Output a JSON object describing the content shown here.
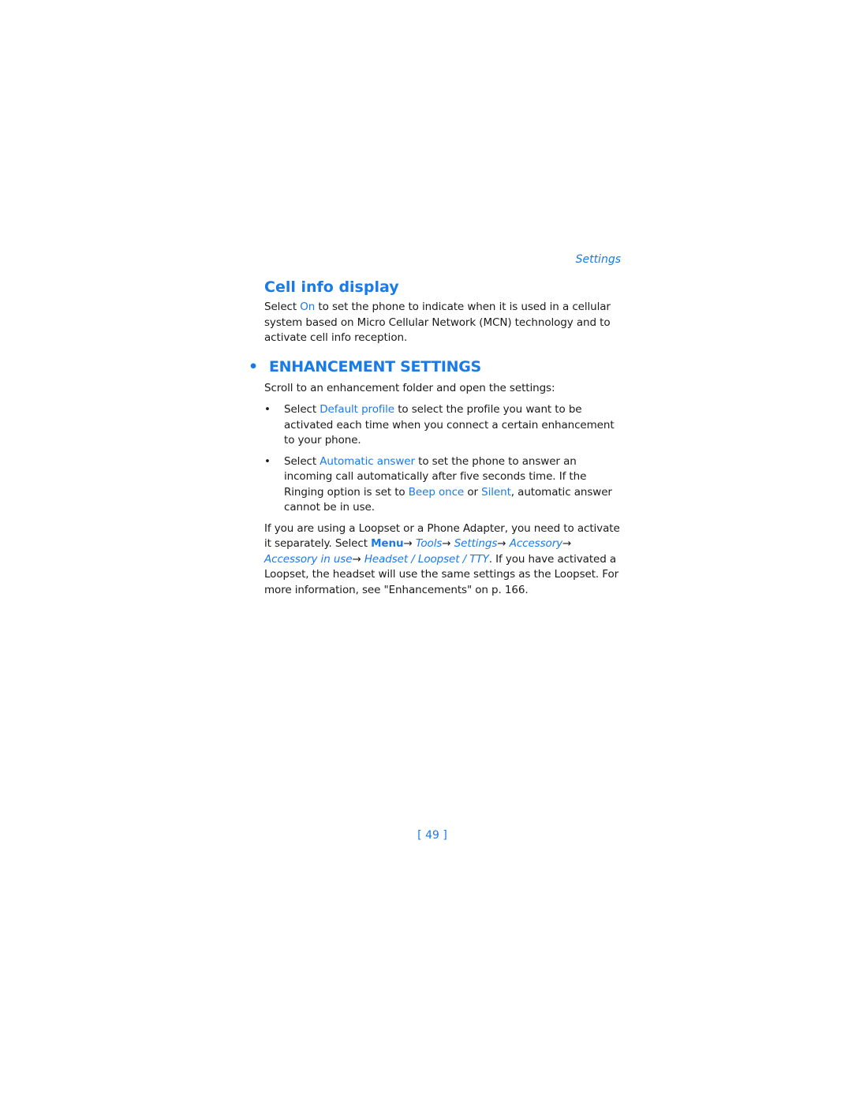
{
  "running_head": "Settings",
  "cell_info": {
    "title": "Cell info display",
    "p_before": "Select ",
    "p_link": "On",
    "p_after": " to set the phone to indicate when it is used in a cellular system based on Micro Cellular Network (MCN) technology and to activate cell info reception."
  },
  "enhancement": {
    "bullet": "•",
    "title": "ENHANCEMENT SETTINGS",
    "intro": "Scroll to an enhancement folder and open the settings:",
    "items": [
      {
        "bullet": "•",
        "before": "Select ",
        "link": "Default profile",
        "after": " to select the profile you want to be activated each time when you connect a certain enhancement to your phone."
      },
      {
        "bullet": "•",
        "before": "Select ",
        "link": "Automatic answer",
        "middle": " to set the phone to answer an incoming call automatically after five seconds time. If the Ringing option is set to ",
        "link2": "Beep once",
        "or": " or ",
        "link3": "Silent",
        "after": ", automatic answer cannot be in use."
      }
    ],
    "para": {
      "before": "If you are using a Loopset or a Phone Adapter, you need to activate it separately. Select ",
      "menu": "Menu",
      "arrow": "→ ",
      "path": [
        "Tools",
        "Settings",
        "Accessory",
        "Accessory in use",
        "Headset / Loopset / TTY"
      ],
      "after": ". If you have activated a Loopset, the headset will use the same settings as the Loopset. For more information, see \"Enhancements\" on p. 166."
    }
  },
  "page_number": "[ 49 ]"
}
